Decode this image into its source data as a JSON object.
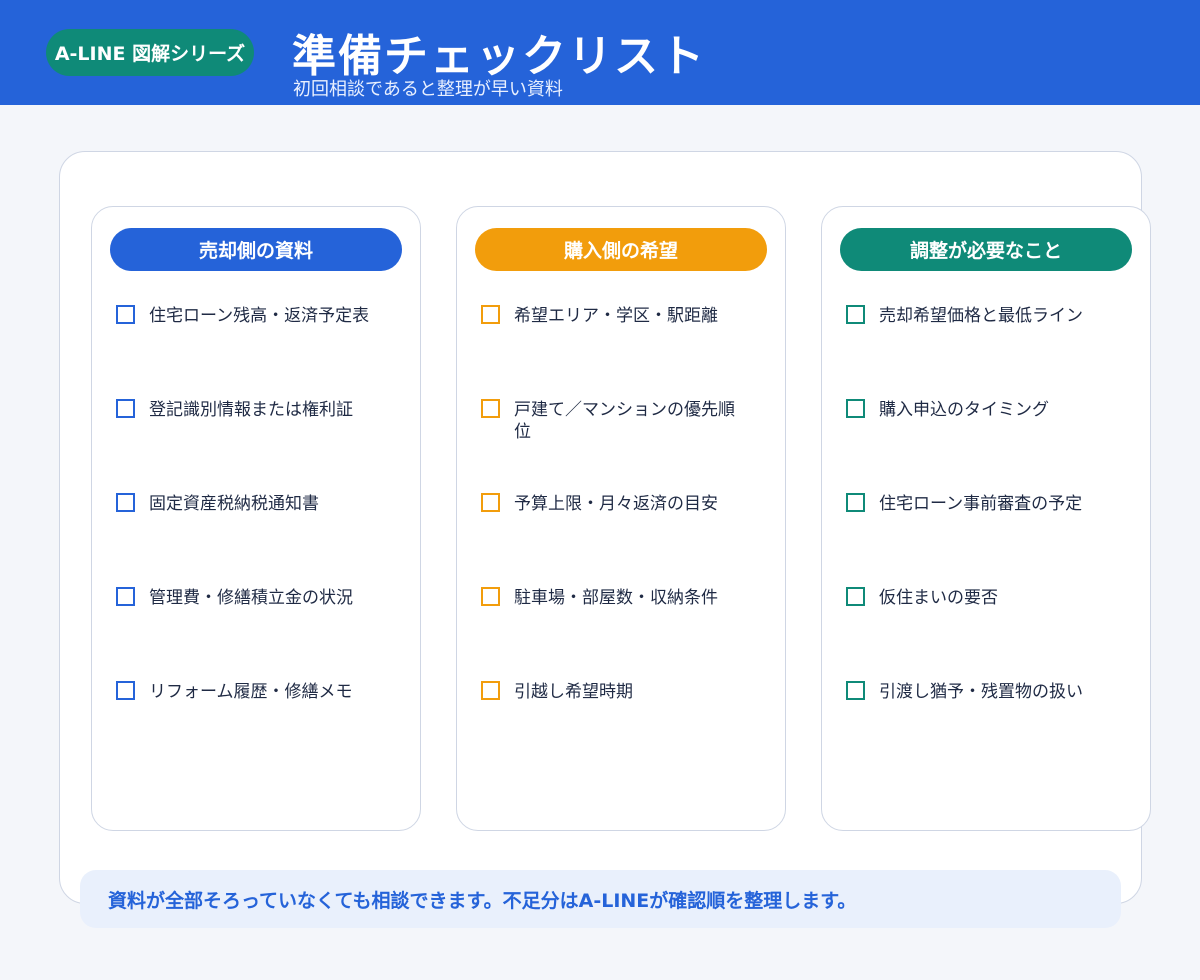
{
  "header": {
    "badge": "A-LINE 図解シリーズ",
    "title": "準備チェックリスト",
    "subtitle": "初回相談であると整理が早い資料"
  },
  "colors": {
    "header_bg": "#2563d9",
    "badge_bg": "#0f8a78",
    "blue": "#2563d9",
    "orange": "#f29d0c",
    "teal": "#0f8a78"
  },
  "columns": [
    {
      "title": "売却側の資料",
      "color": "#2563d9",
      "items": [
        "住宅ローン残高・返済予定表",
        "登記識別情報または権利証",
        "固定資産税納税通知書",
        "管理費・修繕積立金の状況",
        "リフォーム履歴・修繕メモ"
      ]
    },
    {
      "title": "購入側の希望",
      "color": "#f29d0c",
      "items": [
        "希望エリア・学区・駅距離",
        "戸建て／マンションの優先順位",
        "予算上限・月々返済の目安",
        "駐車場・部屋数・収納条件",
        "引越し希望時期"
      ]
    },
    {
      "title": "調整が必要なこと",
      "color": "#0f8a78",
      "items": [
        "売却希望価格と最低ライン",
        "購入申込のタイミング",
        "住宅ローン事前審査の予定",
        "仮住まいの要否",
        "引渡し猶予・残置物の扱い"
      ]
    }
  ],
  "footer": {
    "note": "資料が全部そろっていなくても相談できます。不足分はA-LINEが確認順を整理します。"
  }
}
